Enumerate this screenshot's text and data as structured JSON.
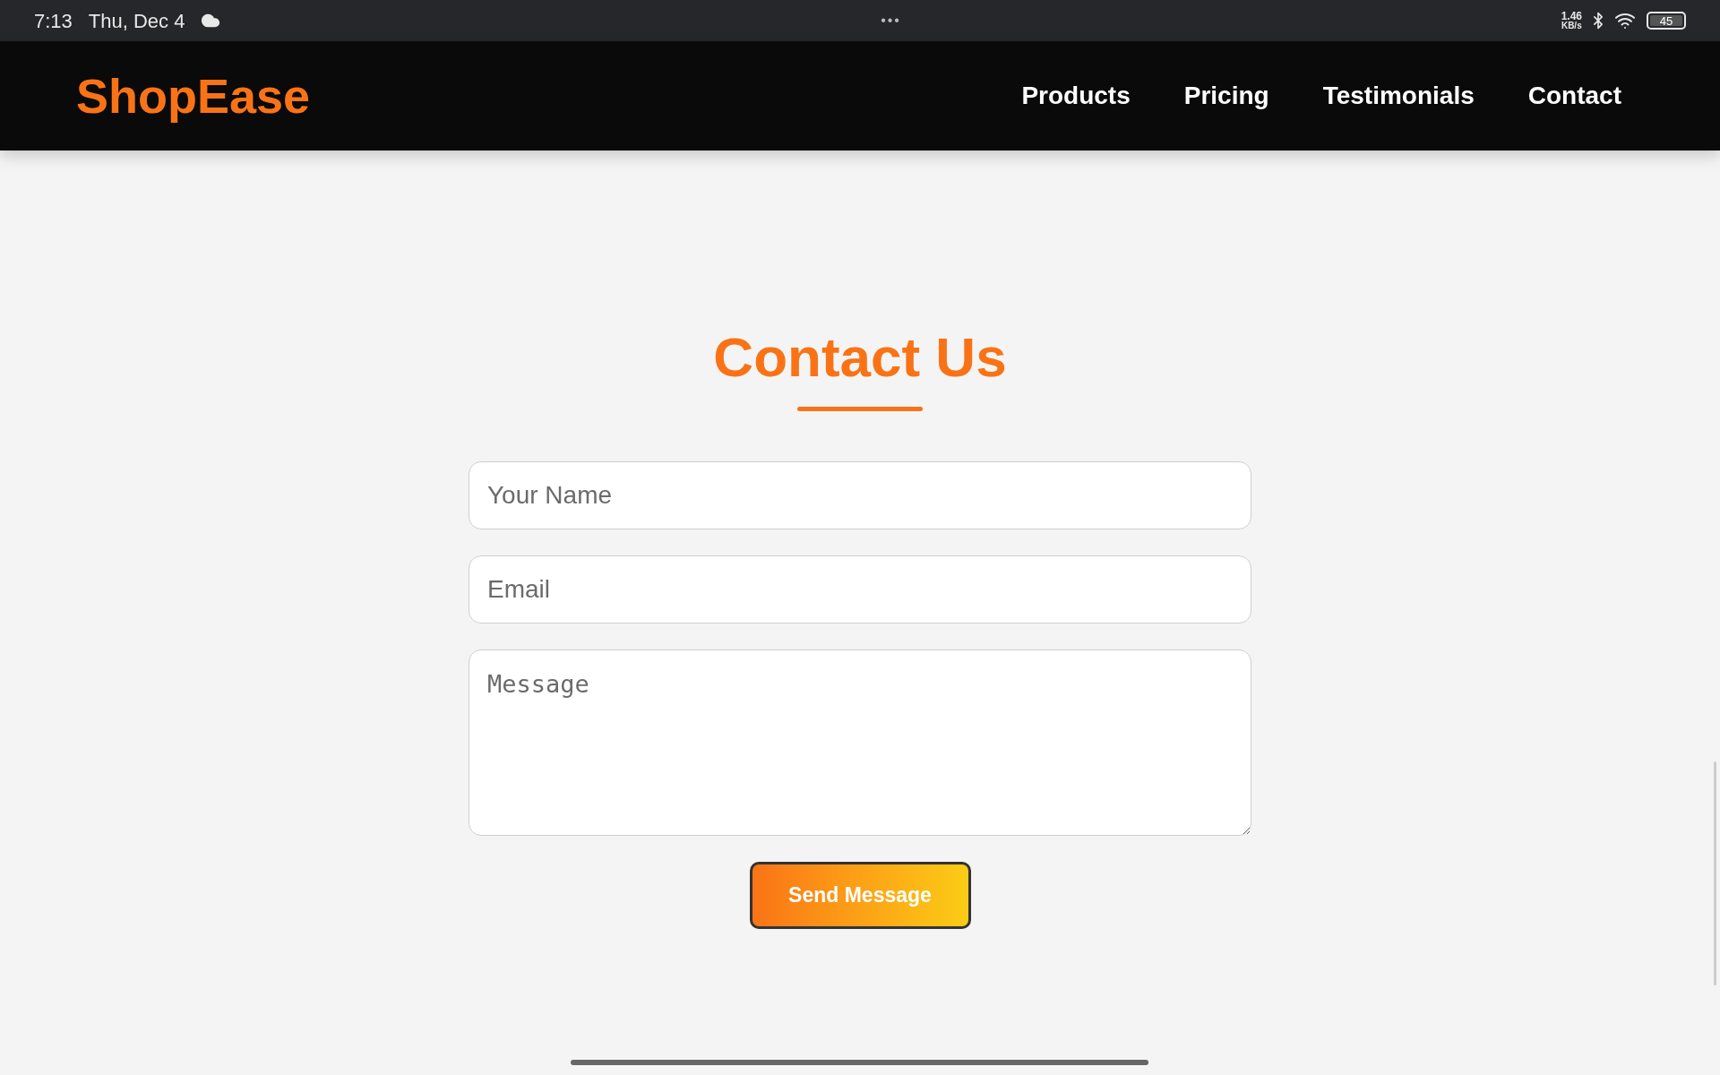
{
  "status_bar": {
    "time": "7:13",
    "date": "Thu, Dec 4",
    "menu_dots": "•••",
    "net_speed": "1.46",
    "net_unit": "KB/s",
    "battery": "45"
  },
  "navbar": {
    "logo": "ShopEase",
    "links": [
      {
        "label": "Products"
      },
      {
        "label": "Pricing"
      },
      {
        "label": "Testimonials"
      },
      {
        "label": "Contact"
      }
    ]
  },
  "contact": {
    "title": "Contact Us",
    "fields": [
      {
        "kind": "input",
        "placeholder": "Your Name"
      },
      {
        "kind": "input",
        "placeholder": "Email"
      },
      {
        "kind": "textarea",
        "placeholder": "Message"
      }
    ],
    "button": "Send Message"
  }
}
